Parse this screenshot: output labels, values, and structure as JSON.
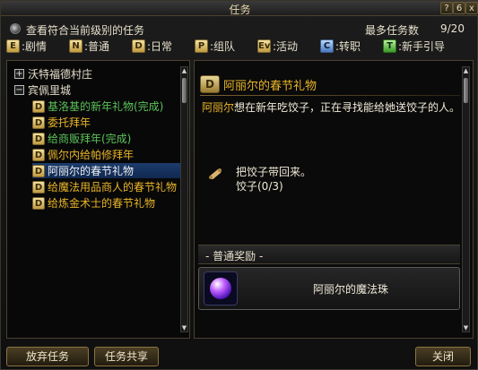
{
  "window": {
    "title": "任务",
    "help": "?",
    "pin": "6",
    "close": "x"
  },
  "filter": {
    "label": "查看符合当前级别的任务",
    "max_label": "最多任务数",
    "max_value": "9/20"
  },
  "legend": [
    {
      "key": "E",
      "label": ":剧情"
    },
    {
      "key": "N",
      "label": ":普通"
    },
    {
      "key": "D",
      "label": ":日常"
    },
    {
      "key": "P",
      "label": ":组队"
    },
    {
      "key": "Ev",
      "label": ":活动"
    },
    {
      "key": "C",
      "label": ":转职"
    },
    {
      "key": "T",
      "label": ":新手引导"
    }
  ],
  "tree": {
    "regions": [
      {
        "expander": "+",
        "name": "沃特福德村庄"
      },
      {
        "expander": "−",
        "name": "宾佩里城"
      }
    ],
    "quests": [
      {
        "type": "D",
        "name": "基洛基的新年礼物(完成)",
        "color": "green"
      },
      {
        "type": "D",
        "name": "委托拜年",
        "color": "gold"
      },
      {
        "type": "D",
        "name": "给商贩拜年(完成)",
        "color": "green"
      },
      {
        "type": "D",
        "name": "佩尔内给帕修拜年",
        "color": "gold"
      },
      {
        "type": "D",
        "name": "阿丽尔的春节礼物",
        "color": "white",
        "selected": true
      },
      {
        "type": "D",
        "name": "给魔法用品商人的春节礼物",
        "color": "gold"
      },
      {
        "type": "D",
        "name": "给炼金术士的春节礼物",
        "color": "gold"
      }
    ]
  },
  "detail": {
    "icon_letter": "D",
    "title": "阿丽尔的春节礼物",
    "npc": "阿丽尔",
    "description": "想在新年吃饺子，正在寻找能给她送饺子的人。",
    "objective": "把饺子带回来。",
    "progress": "饺子(0/3)",
    "reward_header": "- 普通奖励 -",
    "reward_item": "阿丽尔的魔法珠"
  },
  "buttons": {
    "abandon": "放弃任务",
    "share": "任务共享",
    "close": "关闭"
  }
}
